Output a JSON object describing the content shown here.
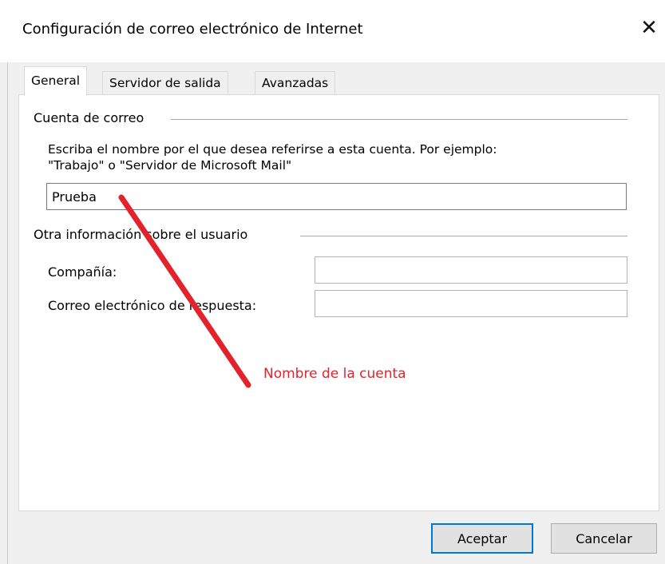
{
  "window": {
    "title": "Configuración de correo electrónico de Internet",
    "close_glyph": "✕"
  },
  "tabs": [
    {
      "label": "General",
      "active": true
    },
    {
      "label": "Servidor de salida",
      "active": false
    },
    {
      "label": "Avanzadas",
      "active": false
    }
  ],
  "account_group": {
    "label": "Cuenta de correo",
    "description_line1": "Escriba el nombre por el que desea referirse a esta cuenta. Por ejemplo:",
    "description_line2": "\"Trabajo\" o \"Servidor de Microsoft Mail\"",
    "account_name_value": "Prueba"
  },
  "user_group": {
    "label": "Otra información sobre el usuario",
    "company_label": "Compañía:",
    "company_value": "",
    "reply_email_label": "Correo electrónico de respuesta:",
    "reply_email_value": ""
  },
  "buttons": {
    "ok_label": "Aceptar",
    "cancel_label": "Cancelar"
  },
  "annotation": {
    "text": "Nombre de la cuenta",
    "color": "#e3222b"
  },
  "colors": {
    "focus_border": "#0078d7",
    "panel_background": "#ffffff",
    "dialog_background": "#f0f0f0"
  }
}
